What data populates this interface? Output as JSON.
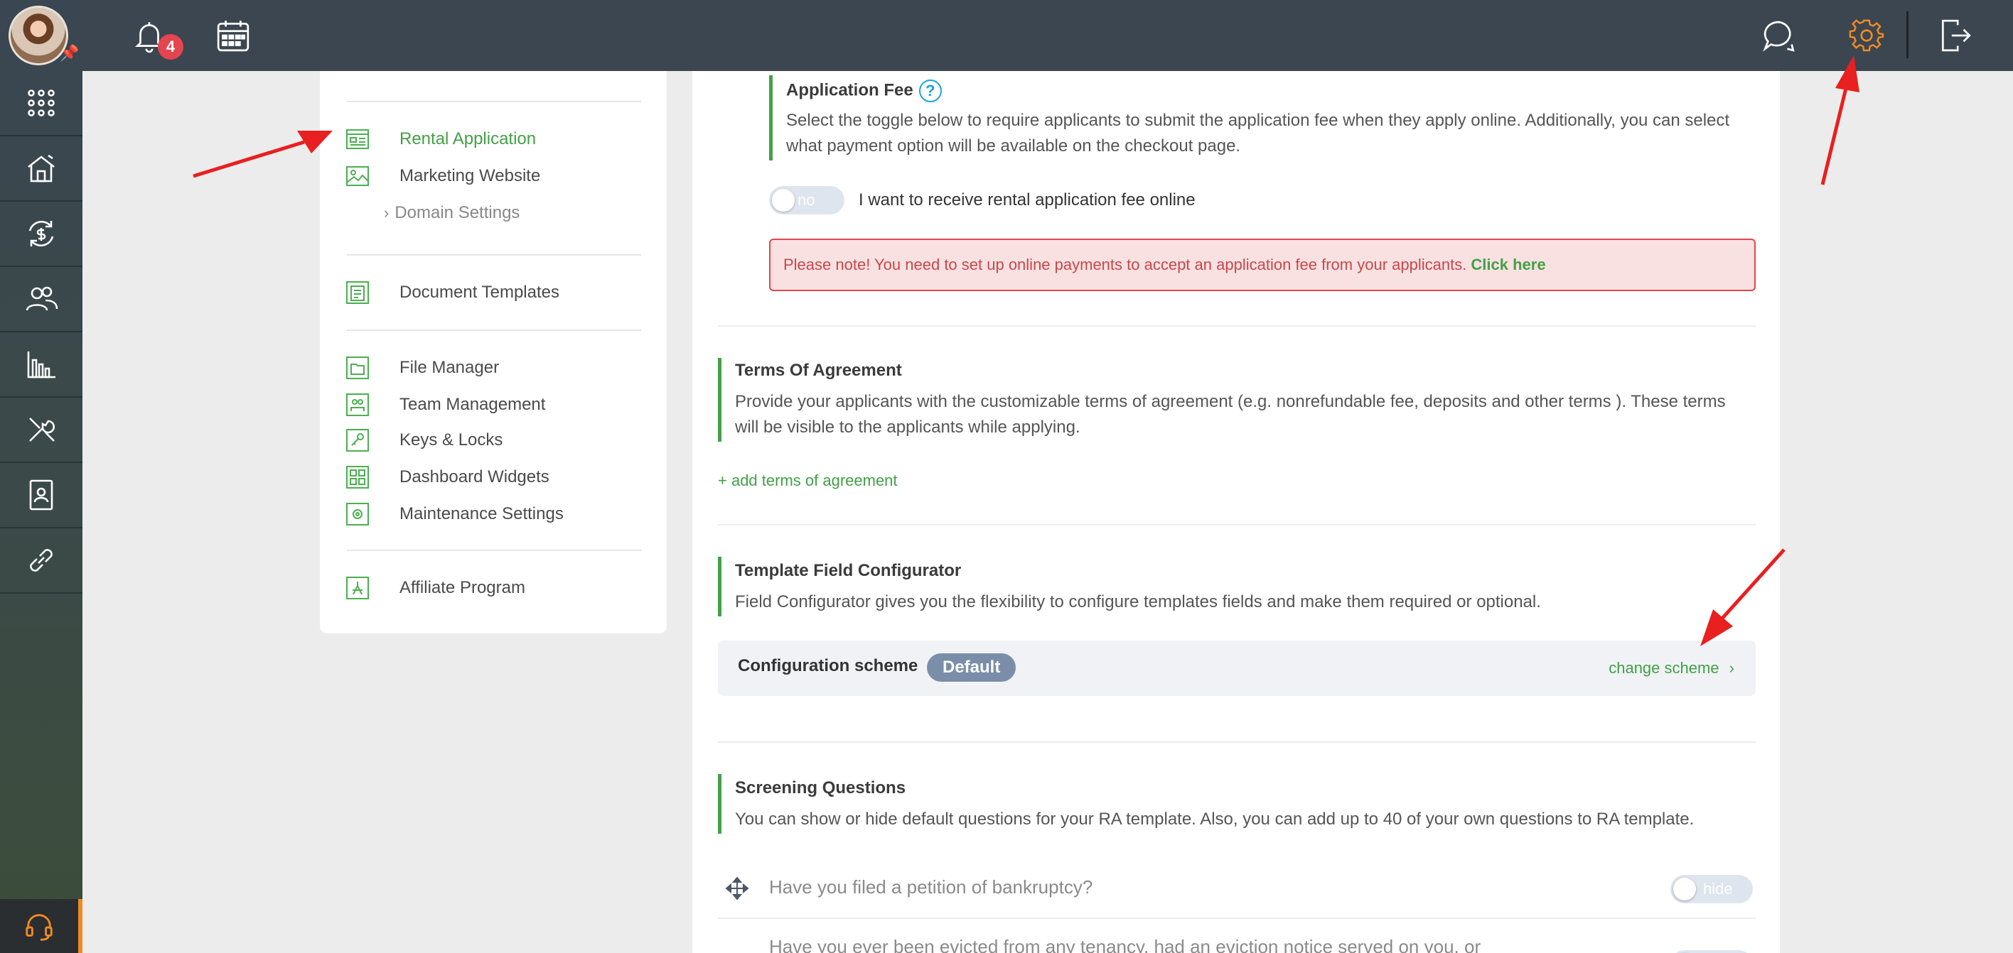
{
  "topbar": {
    "notifications_count": "4"
  },
  "settings_menu": {
    "rental_application": "Rental Application",
    "marketing_website": "Marketing Website",
    "domain_settings": "Domain Settings",
    "document_templates": "Document Templates",
    "file_manager": "File Manager",
    "team_management": "Team Management",
    "keys_locks": "Keys & Locks",
    "dashboard_widgets": "Dashboard Widgets",
    "maintenance_settings": "Maintenance Settings",
    "affiliate_program": "Affiliate Program"
  },
  "application_fee": {
    "title": "Application Fee",
    "help": "?",
    "description": "Select the toggle below to require applicants to submit the application fee when they apply online. Additionally, you can select what payment option will be available on the checkout page.",
    "toggle_state": "no",
    "toggle_label": "I want to receive rental application fee online",
    "alert_text": "Please note! You need to set up online payments to accept an application fee from your applicants. ",
    "alert_link": "Click here"
  },
  "terms": {
    "title": "Terms Of Agreement",
    "description": "Provide your applicants with the customizable terms of agreement (e.g. nonrefundable fee, deposits and other terms ). These terms will be visible to the applicants while applying.",
    "add_link": "+ add terms of agreement"
  },
  "template_config": {
    "title": "Template Field Configurator",
    "description": "Field Configurator gives you the flexibility to configure templates fields and make them required or optional.",
    "scheme_label": "Configuration scheme",
    "scheme_value": "Default",
    "change_link": "change scheme"
  },
  "screening": {
    "title": "Screening Questions",
    "description": "You can show or hide default questions for your RA template. Also, you can add up to 40 of your own questions to RA template.",
    "questions": [
      {
        "text": "Have you filed a petition of bankruptcy?",
        "toggle": "hide"
      },
      {
        "text": "Have you ever been evicted from any tenancy, had an eviction notice served on you, or",
        "toggle": "hide"
      }
    ]
  },
  "colors": {
    "accent": "#43a047",
    "topbar": "#3b4650",
    "alert_border": "#e0474f",
    "gear_active": "#f08a24"
  },
  "icons": {
    "rail": [
      "apps-grid-icon",
      "house-icon",
      "money-cycle-icon",
      "people-icon",
      "chart-icon",
      "tools-icon",
      "contact-card-icon",
      "link-icon",
      "headset-icon"
    ],
    "topbar": [
      "bell-icon",
      "calendar-icon",
      "chat-icon",
      "gear-icon",
      "logout-icon"
    ]
  }
}
